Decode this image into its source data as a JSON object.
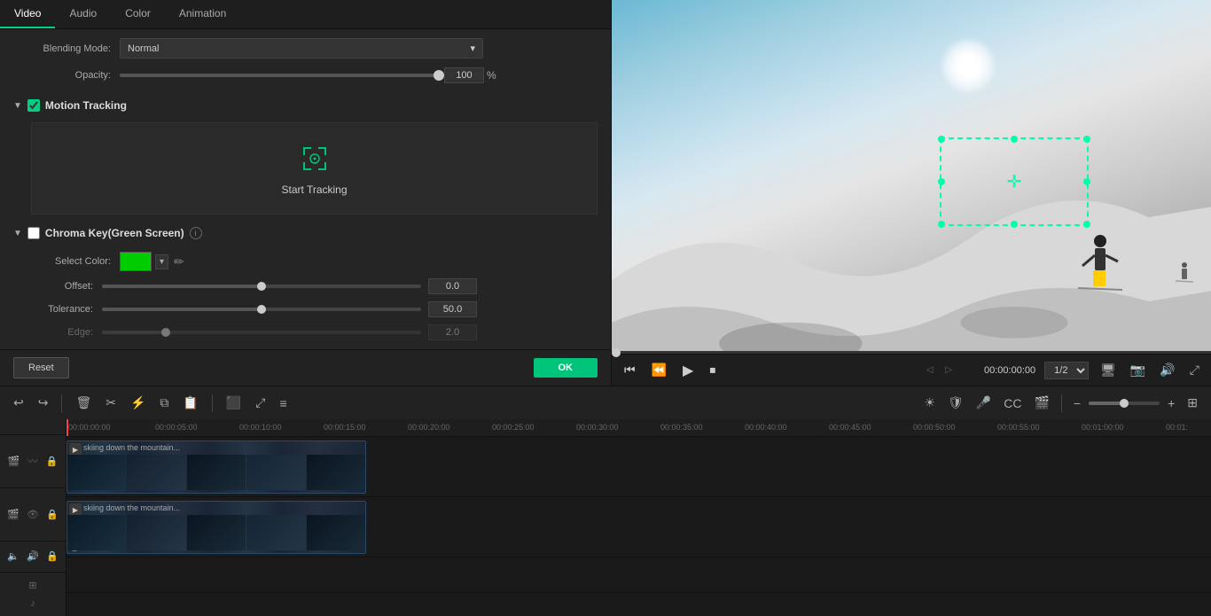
{
  "tabs": [
    {
      "id": "video",
      "label": "Video",
      "active": true
    },
    {
      "id": "audio",
      "label": "Audio",
      "active": false
    },
    {
      "id": "color",
      "label": "Color",
      "active": false
    },
    {
      "id": "animation",
      "label": "Animation",
      "active": false
    }
  ],
  "blending": {
    "label": "Blending Mode:",
    "value": "Normal"
  },
  "opacity": {
    "label": "Opacity:",
    "value": "100",
    "unit": "%",
    "fill_pct": 100
  },
  "motion_tracking": {
    "section_title": "Motion Tracking",
    "enabled": true,
    "button_label": "Start Tracking"
  },
  "chroma_key": {
    "section_title": "Chroma Key(Green Screen)",
    "enabled": false,
    "select_color_label": "Select Color:",
    "color_value": "#00cc00",
    "offset_label": "Offset:",
    "offset_value": "0.0",
    "offset_pct": 50,
    "tolerance_label": "Tolerance:",
    "tolerance_value": "50.0",
    "tolerance_pct": 50,
    "edge_label": "Edge:",
    "edge_value": "2.0"
  },
  "buttons": {
    "reset_label": "Reset",
    "ok_label": "OK"
  },
  "playback": {
    "time_display": "00:00:00:00",
    "ratio": "1/2"
  },
  "ruler": {
    "marks": [
      "00:00:00:00",
      "00:00:05:00",
      "00:00:10:00",
      "00:00:15:00",
      "00:00:20:00",
      "00:00:25:00",
      "00:00:30:00",
      "00:00:35:00",
      "00:00:40:00",
      "00:00:45:00",
      "00:00:50:00",
      "00:00:55:00",
      "00:01:00:00",
      "00:01:"
    ]
  },
  "clips": [
    {
      "id": "clip1",
      "label": "skiing down the mountain...",
      "track": "video1"
    },
    {
      "id": "clip2",
      "label": "skiing down the mountain...",
      "track": "video2"
    }
  ],
  "icons": {
    "undo": "↩",
    "redo": "↪",
    "delete": "🗑",
    "cut": "✂",
    "split": "⚡",
    "copy": "⧉",
    "paste": "📋",
    "crop": "⬛",
    "fit": "⤢",
    "adjust": "≡",
    "sun": "☀",
    "shield": "🛡",
    "mic": "🎤",
    "caption": "CC",
    "media": "🎬",
    "zoom_minus": "−",
    "zoom_plus": "+",
    "prev_frame": "⏮",
    "play": "▶",
    "next_frame": "⏭",
    "stop": "⏹",
    "rewind": "⏪"
  }
}
